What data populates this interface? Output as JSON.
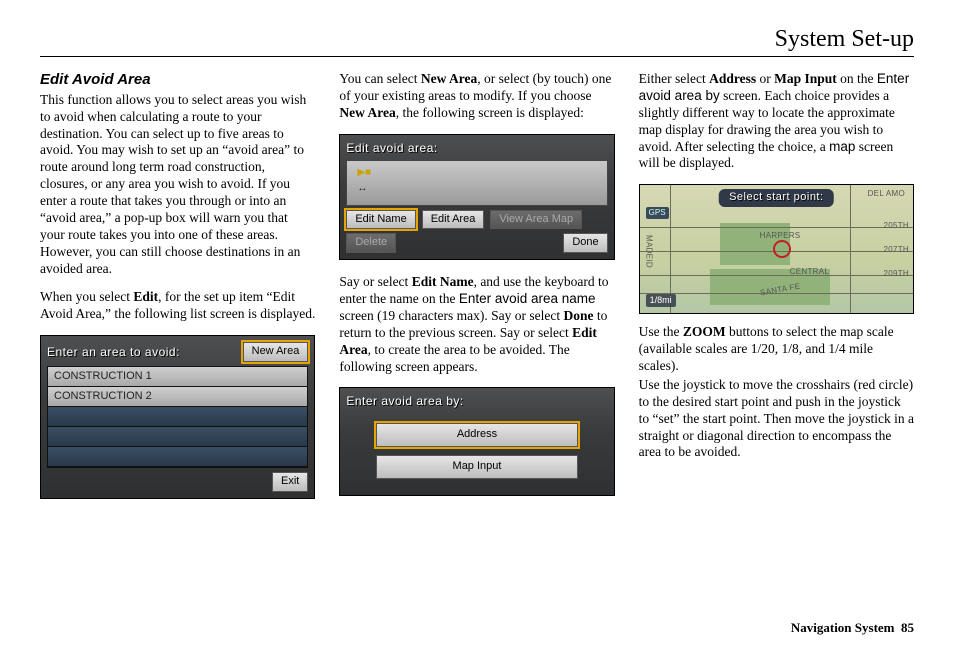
{
  "page_title": "System Set-up",
  "footer": {
    "label": "Navigation System",
    "page": "85"
  },
  "col1": {
    "heading": "Edit Avoid Area",
    "p1": "This function allows you to select areas you wish to avoid when calculating a route to your destination. You can select up to five areas to avoid. You may wish to set up an “avoid area” to route around long term road construction, closures, or any area you wish to avoid. If you enter a route that takes you through or into an “avoid area,” a pop-up box will warn you that your route takes you into one of these areas. However, you can still choose destinations in an avoided area.",
    "p2a": "When you select ",
    "p2b": "Edit",
    "p2c": ", for the set up item “Edit Avoid Area,” the following list screen is displayed.",
    "device1": {
      "title": "Enter an area to avoid:",
      "new_area": "New Area",
      "rows": [
        "CONSTRUCTION 1",
        "CONSTRUCTION 2",
        "",
        "",
        ""
      ],
      "exit": "Exit"
    }
  },
  "col2": {
    "p1a": "You can select ",
    "p1b": "New Area",
    "p1c": ", or select (by touch) one of your existing areas to modify. If you choose ",
    "p1d": "New Area",
    "p1e": ", the following screen is displayed:",
    "device2": {
      "title": "Edit avoid area:",
      "edit_name": "Edit Name",
      "edit_area": "Edit Area",
      "view_map": "View Area Map",
      "delete": "Delete",
      "done": "Done"
    },
    "p2a": "Say or select ",
    "p2b": "Edit Name",
    "p2c": ", and use the keyboard to enter the name on the ",
    "p2d": "Enter avoid area name",
    "p2e": " screen (19 characters max). Say or select ",
    "p2f": "Done",
    "p2g": " to return to the previous screen. Say or select ",
    "p2h": "Edit Area",
    "p2i": ", to create the area to be avoided. The following screen appears.",
    "device3": {
      "title": "Enter avoid area by:",
      "address": "Address",
      "map_input": "Map Input"
    }
  },
  "col3": {
    "p1a": "Either select ",
    "p1b": "Address",
    "p1c": " or ",
    "p1d": "Map Input",
    "p1e": " on the ",
    "p1f": "Enter avoid area by",
    "p1g": " screen. Each choice provides a slightly different way to locate the approximate map display for drawing the area you wish to avoid. After selecting the choice, a ",
    "p1h": "map",
    "p1i": " screen will be displayed.",
    "map": {
      "title": "Select start point:",
      "scale": "1/8mi",
      "gps": "GPS",
      "labels": {
        "delamo": "DEL AMO",
        "harpers": "HARPERS",
        "central": "CENTRAL",
        "santafe": "SANTA FE",
        "madeid": "MADEID",
        "s205": "205TH",
        "s207": "207TH",
        "s209": "209TH"
      }
    },
    "p2a": "Use the ",
    "p2b": "ZOOM",
    "p2c": " buttons to select the map scale (available scales are 1/20, 1/8, and 1/4 mile scales).",
    "p3": "Use the joystick to move the crosshairs (red circle) to the desired start point and push in the joystick to “set” the start point. Then move the joystick in a straight or diagonal direction to encompass the area to be avoided."
  }
}
